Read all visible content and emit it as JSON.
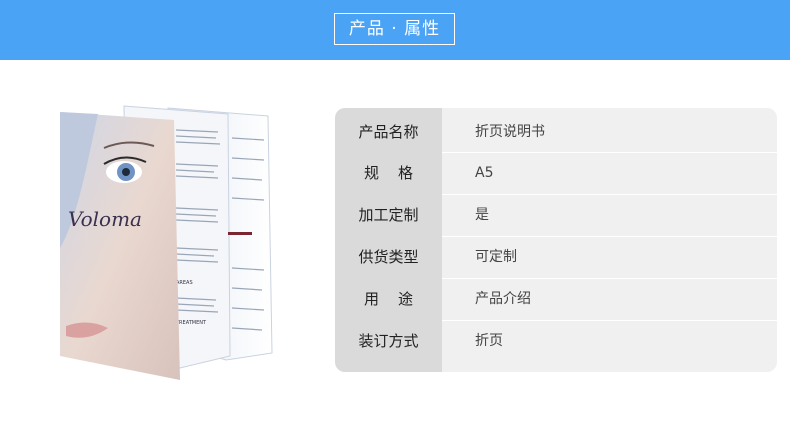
{
  "header": {
    "title": "产品 · 属性",
    "bg_color": "#4aa3f5"
  },
  "product": {
    "brand": "Voloma",
    "panel_headings": [
      "AREAS",
      "TREATMENT"
    ]
  },
  "table": {
    "rows": [
      {
        "label": "产品名称",
        "value": "折页说明书"
      },
      {
        "label": "规    格",
        "value": "A5"
      },
      {
        "label": "加工定制",
        "value": "是"
      },
      {
        "label": "供货类型",
        "value": "可定制"
      },
      {
        "label": "用    途",
        "value": "产品介绍"
      },
      {
        "label": "装订方式",
        "value": "折页"
      }
    ]
  }
}
